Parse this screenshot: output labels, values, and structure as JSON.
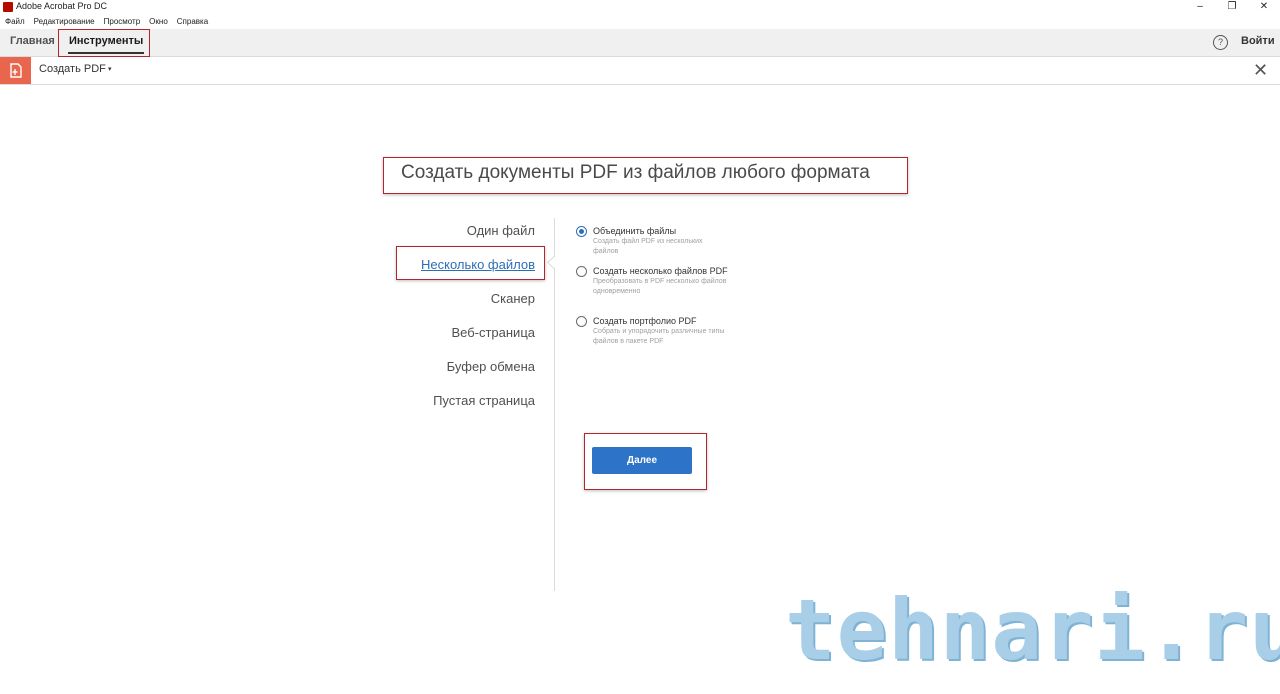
{
  "window": {
    "title": "Adobe Acrobat Pro DC",
    "controls": {
      "minimize": "–",
      "restore": "❐",
      "close": "✕"
    }
  },
  "menu": [
    "Файл",
    "Редактирование",
    "Просмотр",
    "Окно",
    "Справка"
  ],
  "nav": {
    "home": "Главная",
    "tools": "Инструменты",
    "help_icon": "?",
    "signin": "Войти"
  },
  "toolbar": {
    "title": "Создать PDF",
    "caret": "▾",
    "close": "✕",
    "icon": "create-pdf-icon"
  },
  "headline": "Создать документы PDF из файлов любого формата",
  "categories": [
    {
      "label": "Один файл"
    },
    {
      "label": "Несколько файлов",
      "selected": true
    },
    {
      "label": "Сканер"
    },
    {
      "label": "Веб-страница"
    },
    {
      "label": "Буфер обмена"
    },
    {
      "label": "Пустая страница"
    }
  ],
  "options": [
    {
      "title": "Объединить файлы",
      "desc": "Создать файл PDF из нескольких файлов",
      "checked": true
    },
    {
      "title": "Создать несколько файлов PDF",
      "desc": "Преобразовать в PDF несколько файлов одновременно",
      "checked": false
    },
    {
      "title": "Создать портфолио PDF",
      "desc": "Собрать и упорядочить различные типы файлов в пакете PDF",
      "checked": false
    }
  ],
  "next_button": "Далее",
  "watermark": "tehnari.ru",
  "colors": {
    "accent": "#2d73c7",
    "annotation": "#b3262b",
    "tool_badge": "#e8654e"
  }
}
